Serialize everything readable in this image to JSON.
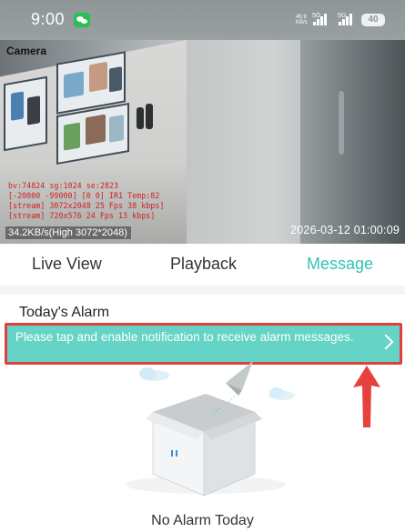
{
  "status_bar": {
    "time": "9:00",
    "app_notification_icon": "wechat-icon",
    "net_speed_value": "45.9",
    "net_speed_unit": "KB/s",
    "sim1_label": "5G",
    "sim2_label": "5G",
    "battery_level": "40"
  },
  "camera": {
    "label": "Camera",
    "osd_lines": [
      "bv:74824 sg:1024 se:2823",
      "[-20000 -99000] [0 0] IR1 Temp:82",
      "[stream] 3072x2048 25 Fps 38 kbps]",
      "[stream] 720x576 24 Fps 13 kbps]"
    ],
    "bitrate": "34.2KB/s(High 3072*2048)",
    "timestamp": "2026-03-12 01:00:09"
  },
  "tabs": [
    {
      "label": "Live View",
      "active": false
    },
    {
      "label": "Playback",
      "active": false
    },
    {
      "label": "Message",
      "active": true
    }
  ],
  "alarm": {
    "section_title": "Today's Alarm",
    "notification_text": "Please tap and enable notification to receive alarm messages.",
    "empty_text": "No Alarm Today"
  },
  "colors": {
    "accent": "#33c3b4",
    "banner_bg": "#66d3c7",
    "highlight": "#e0403c",
    "osd_text": "#d42020"
  }
}
